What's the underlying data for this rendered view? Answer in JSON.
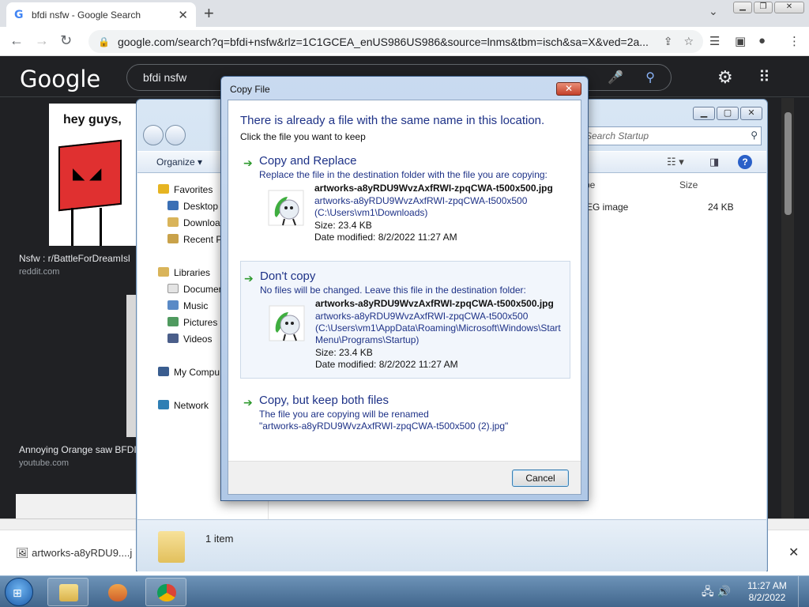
{
  "browser": {
    "tab_title": "bfdi nsfw - Google Search",
    "url": "google.com/search?q=bfdi+nsfw&rlz=1C1GCEA_enUS986US986&source=lnms&tbm=isch&sa=X&ved=2a...",
    "new_tab_label": "+"
  },
  "google": {
    "logo": "Google",
    "query": "bfdi nsfw",
    "result1": {
      "thumb_text": "hey guys,",
      "caption": "Nsfw : r/BattleForDreamIsl",
      "source": "reddit.com"
    },
    "result2": {
      "caption": "Annoying Orange saw BFDI",
      "source": "youtube.com"
    }
  },
  "downloads": {
    "file": "artworks-a8yRDU9....j"
  },
  "explorer": {
    "search_placeholder": "Search Startup",
    "organize_label": "Organize",
    "tree": {
      "favorites": "Favorites",
      "desktop": "Desktop",
      "downloads": "Downloa",
      "recent": "Recent Pl",
      "libraries": "Libraries",
      "documents": "Documen",
      "music": "Music",
      "pictures": "Pictures",
      "videos": "Videos",
      "computer": "My Compu",
      "network": "Network"
    },
    "columns": {
      "type": "ype",
      "size": "Size"
    },
    "row": {
      "type": "PEG image",
      "size": "24 KB"
    },
    "footer_count": "1 item"
  },
  "dialog": {
    "title": "Copy File",
    "heading": "There is already a file with the same name in this location.",
    "subheading": "Click the file you want to keep",
    "replace": {
      "title": "Copy and Replace",
      "desc": "Replace the file in the destination folder with the file you are copying:",
      "file_name": "artworks-a8yRDU9WvzAxfRWI-zpqCWA-t500x500.jpg",
      "path_line1": "artworks-a8yRDU9WvzAxfRWI-zpqCWA-t500x500",
      "path_line2": "(C:\\Users\\vm1\\Downloads)",
      "size": "Size: 23.4 KB",
      "modified": "Date modified: 8/2/2022 11:27 AM"
    },
    "dont_copy": {
      "title": "Don't copy",
      "desc": "No files will be changed. Leave this file in the destination folder:",
      "file_name": "artworks-a8yRDU9WvzAxfRWI-zpqCWA-t500x500.jpg",
      "path_line1": "artworks-a8yRDU9WvzAxfRWI-zpqCWA-t500x500",
      "path_line2": "(C:\\Users\\vm1\\AppData\\Roaming\\Microsoft\\Windows\\Start",
      "path_line3": "Menu\\Programs\\Startup)",
      "size": "Size: 23.4 KB",
      "modified": "Date modified: 8/2/2022 11:27 AM"
    },
    "keep_both": {
      "title": "Copy, but keep both files",
      "desc": "The file you are copying will be renamed",
      "new_name": "\"artworks-a8yRDU9WvzAxfRWI-zpqCWA-t500x500 (2).jpg\""
    },
    "cancel_label": "Cancel"
  },
  "taskbar": {
    "time": "11:27 AM",
    "date": "8/2/2022"
  },
  "colors": {
    "accent_blue": "#1e3287",
    "arrow_green": "#2f9a2f",
    "google_dark": "#202124"
  }
}
